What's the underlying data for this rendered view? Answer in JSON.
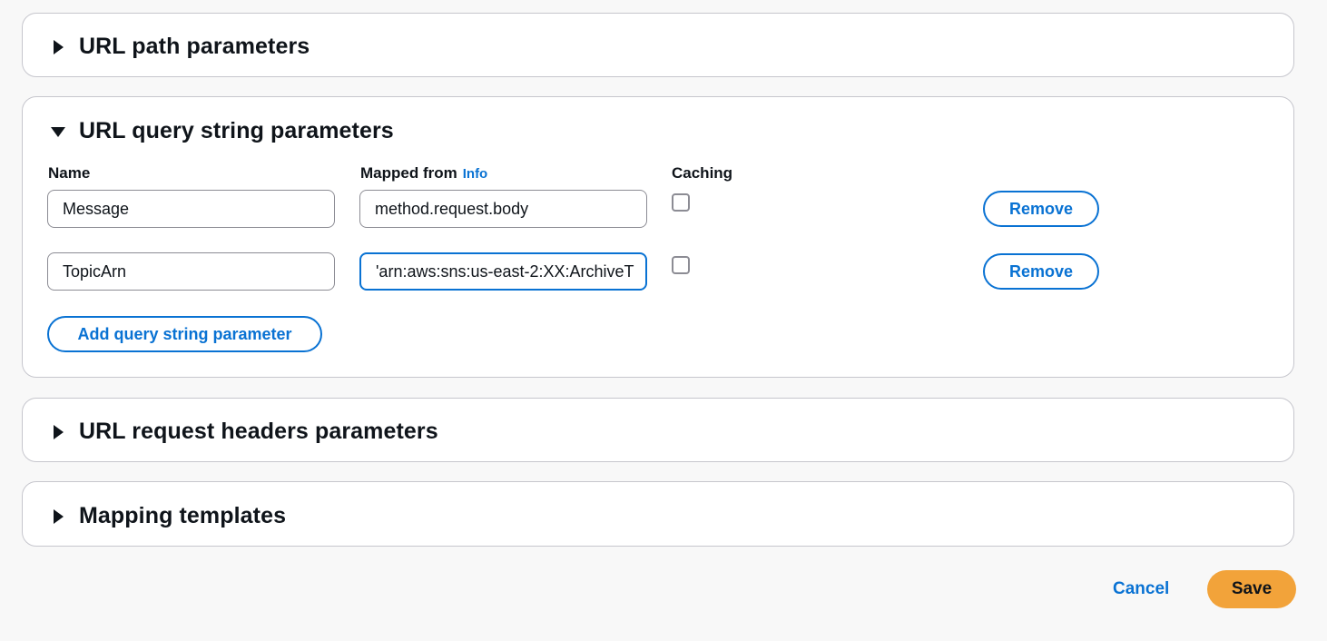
{
  "sections": {
    "path_params": {
      "title": "URL path parameters",
      "expanded": false
    },
    "query_params": {
      "title": "URL query string parameters",
      "expanded": true,
      "columns": {
        "name": "Name",
        "mapped_from": "Mapped from",
        "info": "Info",
        "caching": "Caching"
      },
      "rows": [
        {
          "name": "Message",
          "mapped_from": "method.request.body",
          "caching": false,
          "remove_label": "Remove"
        },
        {
          "name": "TopicArn",
          "mapped_from": "'arn:aws:sns:us-east-2:XX:ArchiveT",
          "caching": false,
          "remove_label": "Remove"
        }
      ],
      "add_label": "Add query string parameter"
    },
    "headers_params": {
      "title": "URL request headers parameters",
      "expanded": false
    },
    "mapping_templates": {
      "title": "Mapping templates",
      "expanded": false
    }
  },
  "footer": {
    "cancel_label": "Cancel",
    "save_label": "Save"
  },
  "colors": {
    "accent": "#0972d3",
    "primary_button": "#f2a33a",
    "border": "#c6c6cd",
    "background": "#f8f8f8"
  },
  "icons": {
    "collapsed": "caret-right-icon",
    "expanded": "caret-down-icon"
  }
}
